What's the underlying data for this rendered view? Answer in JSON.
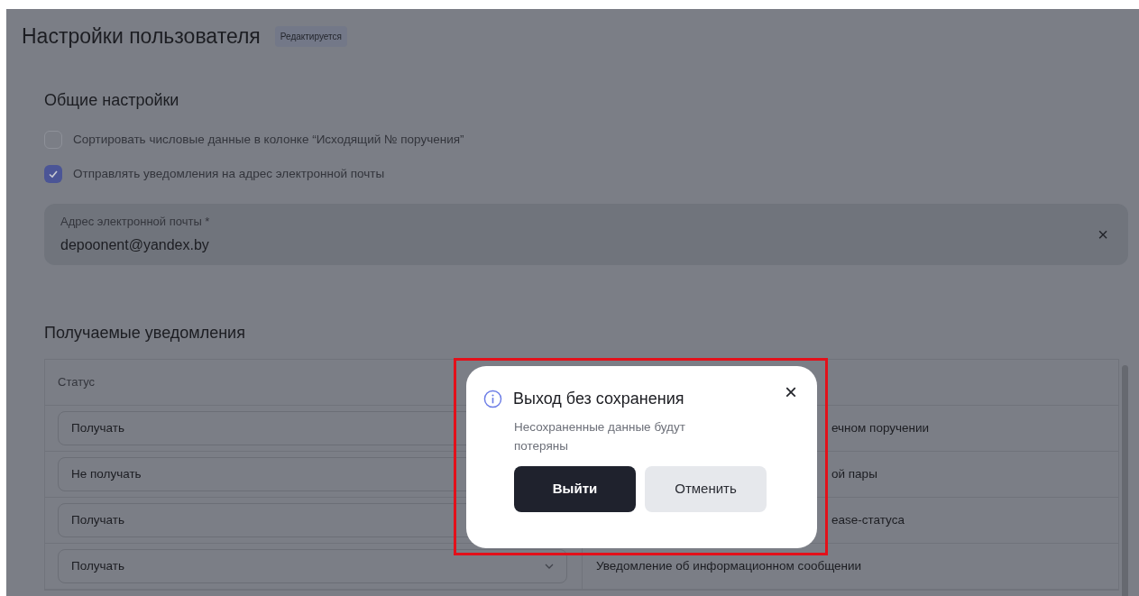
{
  "page": {
    "title": "Настройки пользователя",
    "status_badge": "Редактируется"
  },
  "general": {
    "heading": "Общие настройки",
    "options": [
      {
        "label": "Сортировать числовые данные в колонке “Исходящий № поручения”",
        "checked": false
      },
      {
        "label": "Отправлять уведомления на адрес электронной почты",
        "checked": true
      }
    ],
    "email_field": {
      "label": "Адрес электронной почты *",
      "value": "depoonent@yandex.by",
      "clear": "×"
    }
  },
  "notifications": {
    "heading": "Получаемые уведомления",
    "columns": [
      "Статус"
    ],
    "rows": [
      {
        "status": "Получать",
        "text": "ечном поручении",
        "kind": "clipped"
      },
      {
        "status": "Не получать",
        "text": "ой пары",
        "kind": "clipped"
      },
      {
        "status": "Получать",
        "text": "ease-статуса",
        "kind": "clipped"
      },
      {
        "status": "Получать",
        "text": "Уведомление об информационном сообщении",
        "kind": "full"
      }
    ]
  },
  "dialog": {
    "title": "Выход без сохранения",
    "message": "Несохраненные данные будут потеряны",
    "close": "×",
    "buttons": [
      {
        "label": "Выйти",
        "kind": "primary"
      },
      {
        "label": "Отменить",
        "kind": "secondary"
      }
    ]
  }
}
